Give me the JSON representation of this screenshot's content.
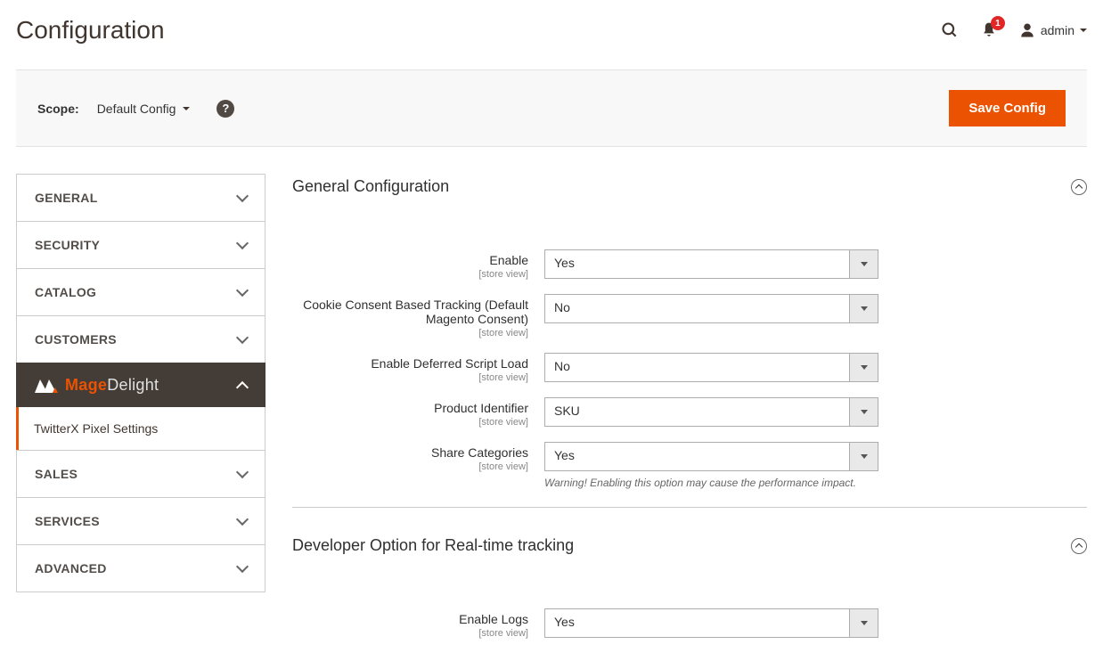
{
  "page": {
    "title": "Configuration"
  },
  "header": {
    "notification_count": "1",
    "username": "admin"
  },
  "scope": {
    "label": "Scope:",
    "value": "Default Config"
  },
  "buttons": {
    "save": "Save Config"
  },
  "sidebar": {
    "items": [
      {
        "label": "GENERAL"
      },
      {
        "label": "SECURITY"
      },
      {
        "label": "CATALOG"
      },
      {
        "label": "CUSTOMERS"
      }
    ],
    "brand_mage": "Mage",
    "brand_delight": "Delight",
    "subitem": "TwitterX Pixel Settings",
    "items_after": [
      {
        "label": "SALES"
      },
      {
        "label": "SERVICES"
      },
      {
        "label": "ADVANCED"
      }
    ]
  },
  "sections": {
    "general": {
      "title": "General Configuration",
      "fields": {
        "enable": {
          "label": "Enable",
          "scope": "[store view]",
          "value": "Yes"
        },
        "cookie": {
          "label": "Cookie Consent Based Tracking (Default Magento Consent)",
          "scope": "[store view]",
          "value": "No"
        },
        "deferred": {
          "label": "Enable Deferred Script Load",
          "scope": "[store view]",
          "value": "No"
        },
        "product_id": {
          "label": "Product Identifier",
          "scope": "[store view]",
          "value": "SKU"
        },
        "share_cat": {
          "label": "Share Categories",
          "scope": "[store view]",
          "value": "Yes",
          "note": "Warning! Enabling this option may cause the performance impact."
        }
      }
    },
    "developer": {
      "title": "Developer Option for Real-time tracking",
      "fields": {
        "enable_logs": {
          "label": "Enable Logs",
          "scope": "[store view]",
          "value": "Yes"
        }
      }
    }
  }
}
